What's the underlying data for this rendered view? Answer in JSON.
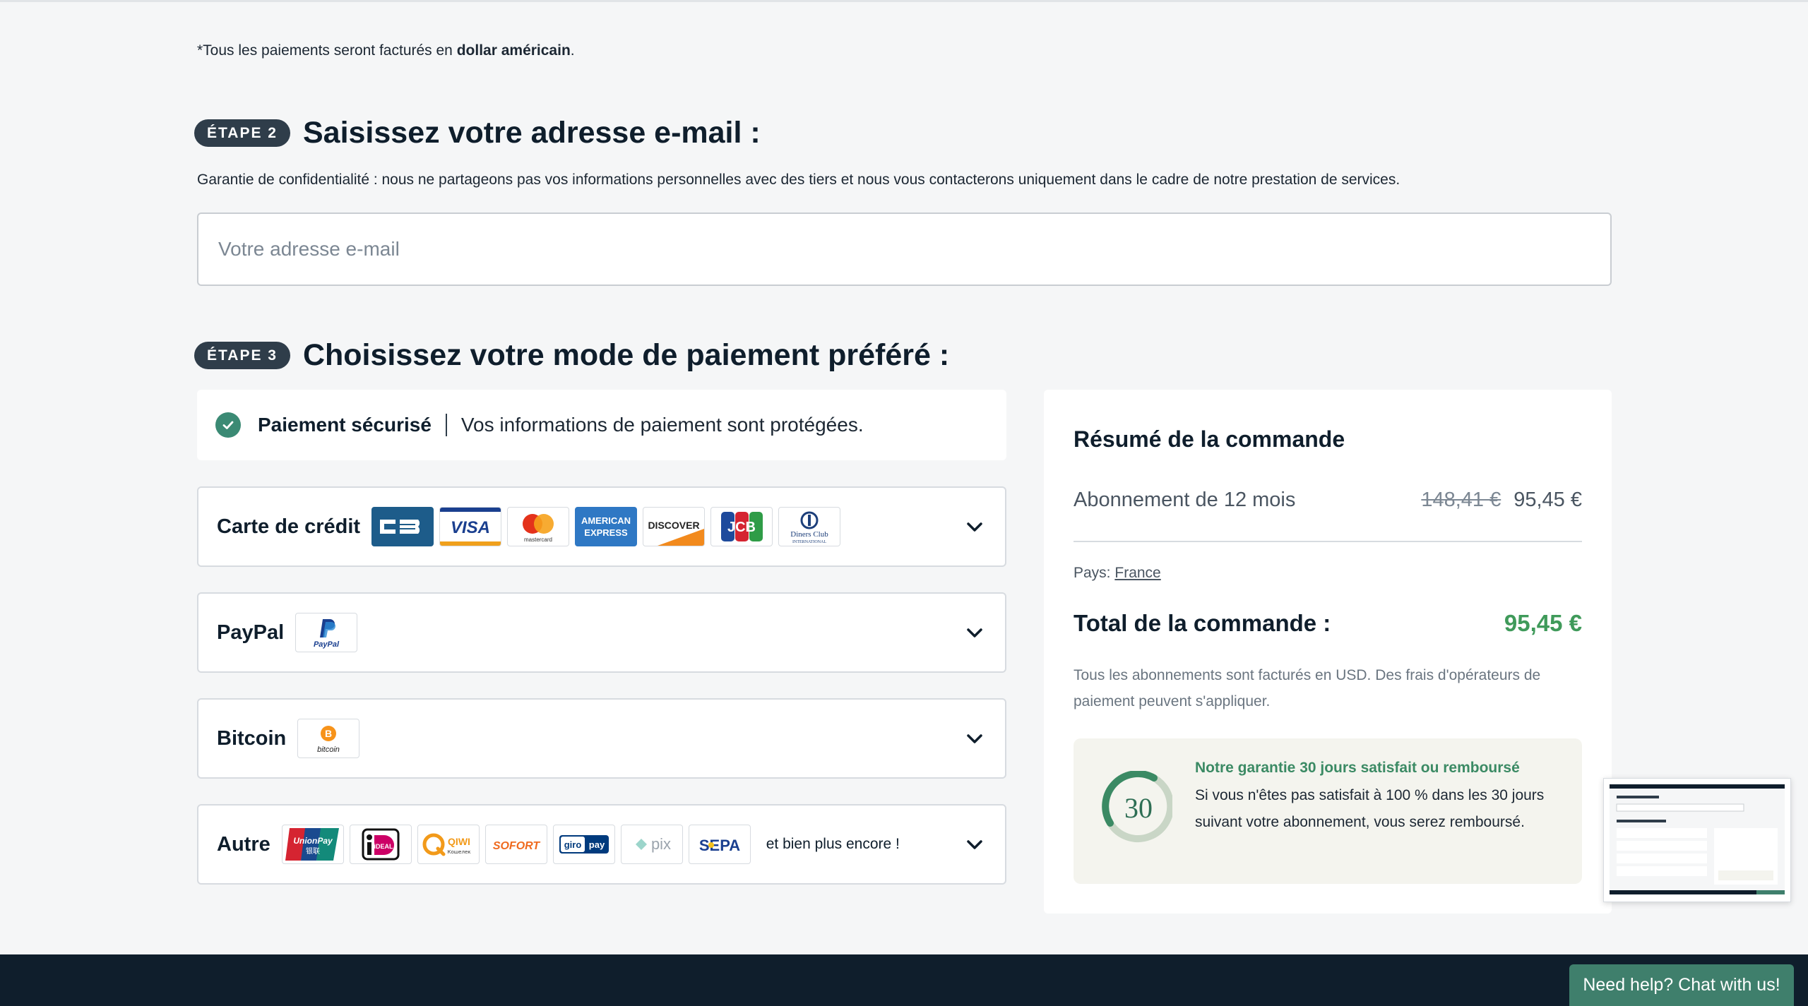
{
  "note": {
    "prefix": "*Tous les paiements seront facturés en ",
    "bold": "dollar américain",
    "suffix": "."
  },
  "step2": {
    "badge": "ÉTAPE 2",
    "title": "Saisissez votre adresse e-mail :",
    "privacy": "Garantie de confidentialité : nous ne partageons pas vos informations personnelles avec des tiers et nous vous contacterons uniquement dans le cadre de notre prestation de services.",
    "email_placeholder": "Votre adresse e-mail",
    "email_value": ""
  },
  "step3": {
    "badge": "ÉTAPE 3",
    "title": "Choisissez votre mode de paiement préféré :"
  },
  "secure": {
    "title": "Paiement sécurisé",
    "text": "Vos informations de paiement sont protégées."
  },
  "payment_methods": [
    {
      "label": "Carte de crédit",
      "logos": [
        "CB",
        "VISA",
        "mastercard",
        "AMERICAN EXPRESS",
        "DISCOVER",
        "JCB",
        "Diners Club INTERNATIONAL"
      ]
    },
    {
      "label": "PayPal",
      "logos": [
        "PayPal"
      ]
    },
    {
      "label": "Bitcoin",
      "logos": [
        "bitcoin"
      ]
    },
    {
      "label": "Autre",
      "logos": [
        "UnionPay 银联",
        "iDEAL",
        "QIWI Кошелек",
        "SOFORT",
        "giropay",
        "pix",
        "SEPA"
      ],
      "more": "et bien plus encore !"
    }
  ],
  "summary": {
    "title": "Résumé de la commande",
    "subscription": "Abonnement de 12 mois",
    "old_price": "148,41 €",
    "price": "95,45 €",
    "country_label": "Pays:",
    "country": "France",
    "total_label": "Total de la commande :",
    "total": "95,45 €",
    "usd_note": "Tous les abonnements sont facturés en USD. Des frais d'opérateurs de paiement peuvent s'appliquer.",
    "guarantee_badge": "30",
    "guarantee_title": "Notre garantie 30 jours satisfait ou remboursé",
    "guarantee_text": "Si vous n'êtes pas satisfait à 100 % dans les 30 jours suivant votre abonnement, vous serez remboursé."
  },
  "chat": {
    "label": "Need help? Chat with us!"
  },
  "colors": {
    "accent_green": "#3f9a5a",
    "dark": "#0f1e2c",
    "chat": "#3f7f6c"
  }
}
